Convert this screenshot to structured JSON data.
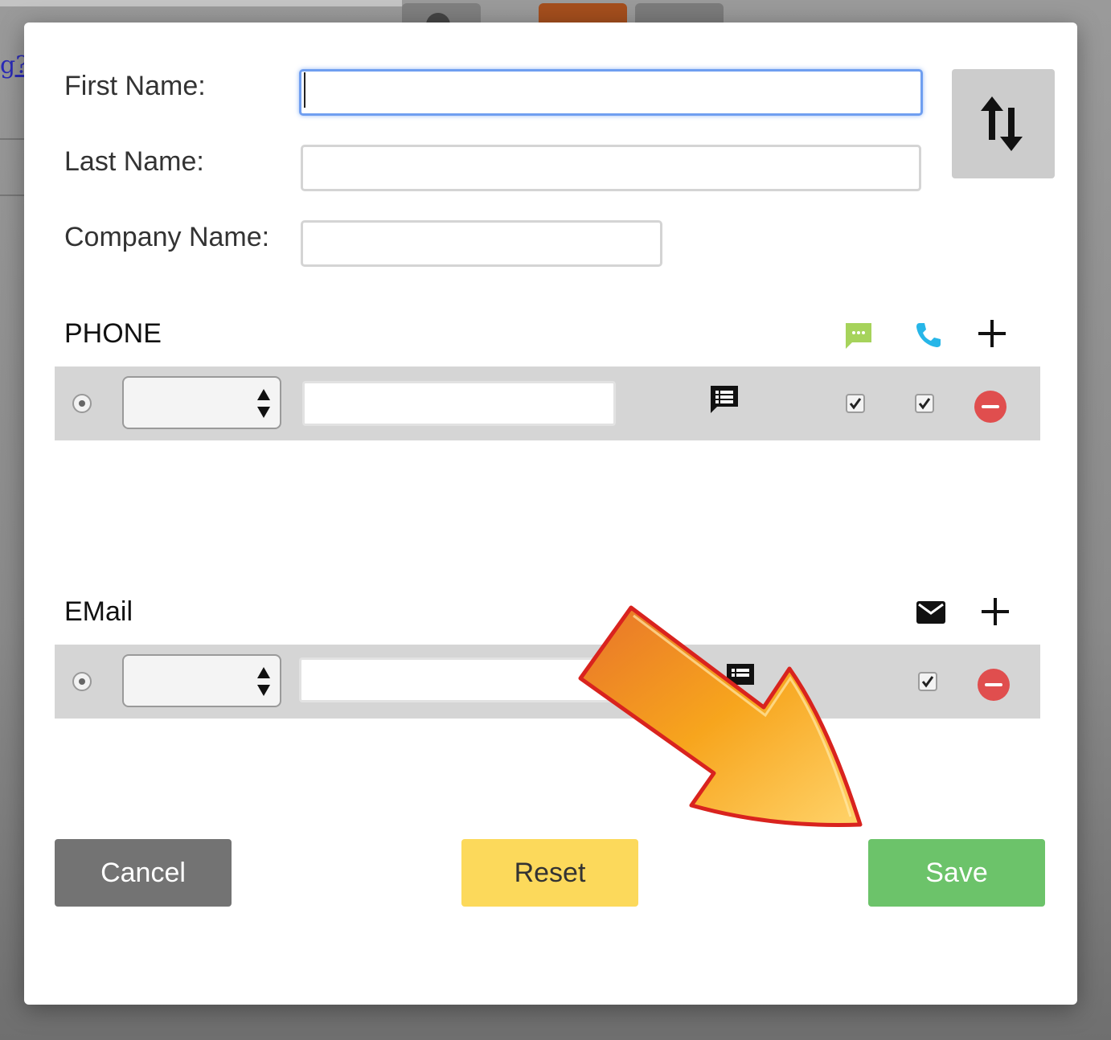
{
  "background": {
    "link_text": "g?"
  },
  "form": {
    "first_name_label": "First Name:",
    "first_name_value": "",
    "last_name_label": "Last Name:",
    "last_name_value": "",
    "company_name_label": "Company Name:",
    "company_name_value": ""
  },
  "phone": {
    "title": "PHONE",
    "header_icons": [
      "sms-icon",
      "phone-icon",
      "plus-icon"
    ],
    "rows": [
      {
        "type_value": "",
        "number_value": "",
        "sms_checked": true,
        "call_checked": true
      }
    ]
  },
  "email": {
    "title": "EMail",
    "header_icons": [
      "envelope-icon",
      "plus-icon"
    ],
    "rows": [
      {
        "type_value": "",
        "address_value": "",
        "mail_checked": true
      }
    ]
  },
  "buttons": {
    "cancel": "Cancel",
    "reset": "Reset",
    "save": "Save"
  },
  "colors": {
    "cancel_bg": "#737373",
    "reset_bg": "#fcd95b",
    "save_bg": "#6cc36a",
    "sms_icon": "#a6d35b",
    "phone_icon": "#27b6e8",
    "remove": "#e04e4e",
    "focus_ring": "#6f9ef0",
    "annotation_arrow": "#f5a11c"
  }
}
